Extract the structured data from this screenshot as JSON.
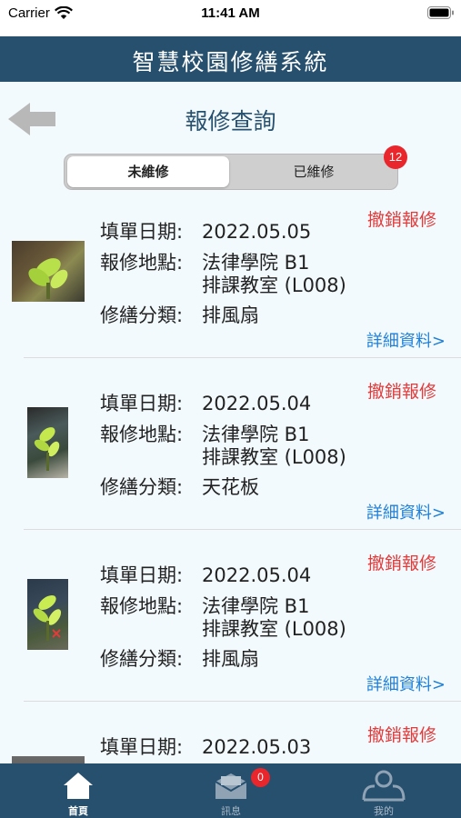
{
  "status_bar": {
    "carrier": "Carrier",
    "time": "11:41 AM"
  },
  "app": {
    "title": "智慧校園修繕系統"
  },
  "page": {
    "title": "報修查詢"
  },
  "segments": {
    "pending": "未維修",
    "completed": "已維修",
    "completed_badge": "12"
  },
  "labels": {
    "date": "填單日期:",
    "location": "報修地點:",
    "category": "修繕分類:"
  },
  "actions": {
    "cancel": "撤銷報修",
    "details": "詳細資料>"
  },
  "records": [
    {
      "date": "2022.05.05",
      "location_line1": "法律學院 B1",
      "location_line2": "排課教室 (L008)",
      "category": "排風扇"
    },
    {
      "date": "2022.05.04",
      "location_line1": "法律學院 B1",
      "location_line2": "排課教室 (L008)",
      "category": "天花板"
    },
    {
      "date": "2022.05.04",
      "location_line1": "法律學院 B1",
      "location_line2": "排課教室 (L008)",
      "category": "排風扇"
    },
    {
      "date": "2022.05.03"
    }
  ],
  "tabs": [
    {
      "label": "首頁",
      "icon": "home-icon"
    },
    {
      "label": "訊息",
      "icon": "mail-icon",
      "badge": "0"
    },
    {
      "label": "我的",
      "icon": "profile-icon"
    }
  ],
  "colors": {
    "primary": "#27506f",
    "danger": "#e33a3a",
    "link": "#1f7fd6",
    "badge": "#e8262c",
    "background": "#f2fafd"
  }
}
